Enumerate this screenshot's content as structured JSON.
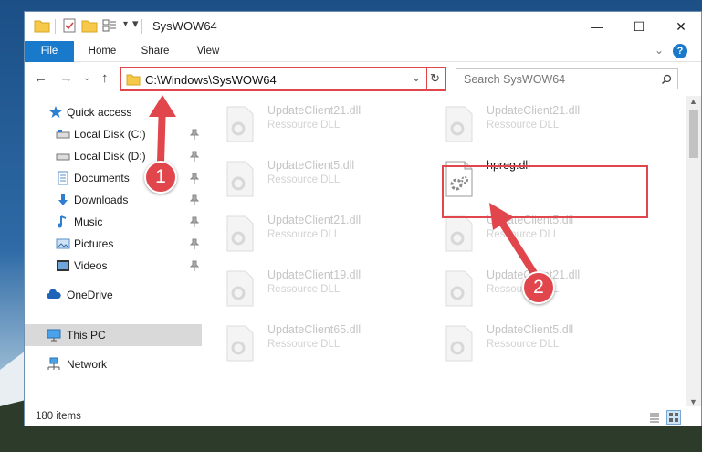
{
  "window": {
    "title": "SysWOW64",
    "minimize": "—",
    "maximize": "☐",
    "close": "✕"
  },
  "ribbon": {
    "tabs": [
      "File",
      "Home",
      "Share",
      "View"
    ],
    "expand_icon": "chevron-down-icon",
    "help_label": "?"
  },
  "nav": {
    "address": "C:\\Windows\\SysWOW64",
    "search_placeholder": "Search SysWOW64"
  },
  "sidebar": {
    "items": [
      {
        "label": "Quick access",
        "icon": "star-icon"
      },
      {
        "label": "Local Disk (C:)",
        "icon": "drive-icon"
      },
      {
        "label": "Local Disk (D:)",
        "icon": "drive-icon"
      },
      {
        "label": "Documents",
        "icon": "documents-icon"
      },
      {
        "label": "Downloads",
        "icon": "downloads-icon"
      },
      {
        "label": "Music",
        "icon": "music-icon"
      },
      {
        "label": "Pictures",
        "icon": "pictures-icon"
      },
      {
        "label": "Videos",
        "icon": "videos-icon"
      },
      {
        "label": "OneDrive",
        "icon": "cloud-icon"
      },
      {
        "label": "This PC",
        "icon": "computer-icon"
      },
      {
        "label": "Network",
        "icon": "network-icon"
      }
    ]
  },
  "files": [
    {
      "name": "UpdateClient21.dll",
      "type": "Ressource DLL"
    },
    {
      "name": "UpdateClient21.dll",
      "type": "Ressource DLL"
    },
    {
      "name": "UpdateClient5.dll",
      "type": "Ressource DLL"
    },
    {
      "name": "hpreg.dll",
      "type": ""
    },
    {
      "name": "UpdateClient21.dll",
      "type": "Ressource DLL"
    },
    {
      "name": "UpdateClient5.dll",
      "type": "Ressource DLL"
    },
    {
      "name": "UpdateClient19.dll",
      "type": "Ressource DLL"
    },
    {
      "name": "UpdateClient21.dll",
      "type": "Ressource DLL"
    },
    {
      "name": "UpdateClient65.dll",
      "type": "Ressource DLL"
    },
    {
      "name": "UpdateClient5.dll",
      "type": "Ressource DLL"
    }
  ],
  "status": {
    "count": "180 items"
  },
  "callouts": [
    "1",
    "2"
  ],
  "colors": {
    "accent": "#1979ca",
    "callout": "#e0464b"
  }
}
